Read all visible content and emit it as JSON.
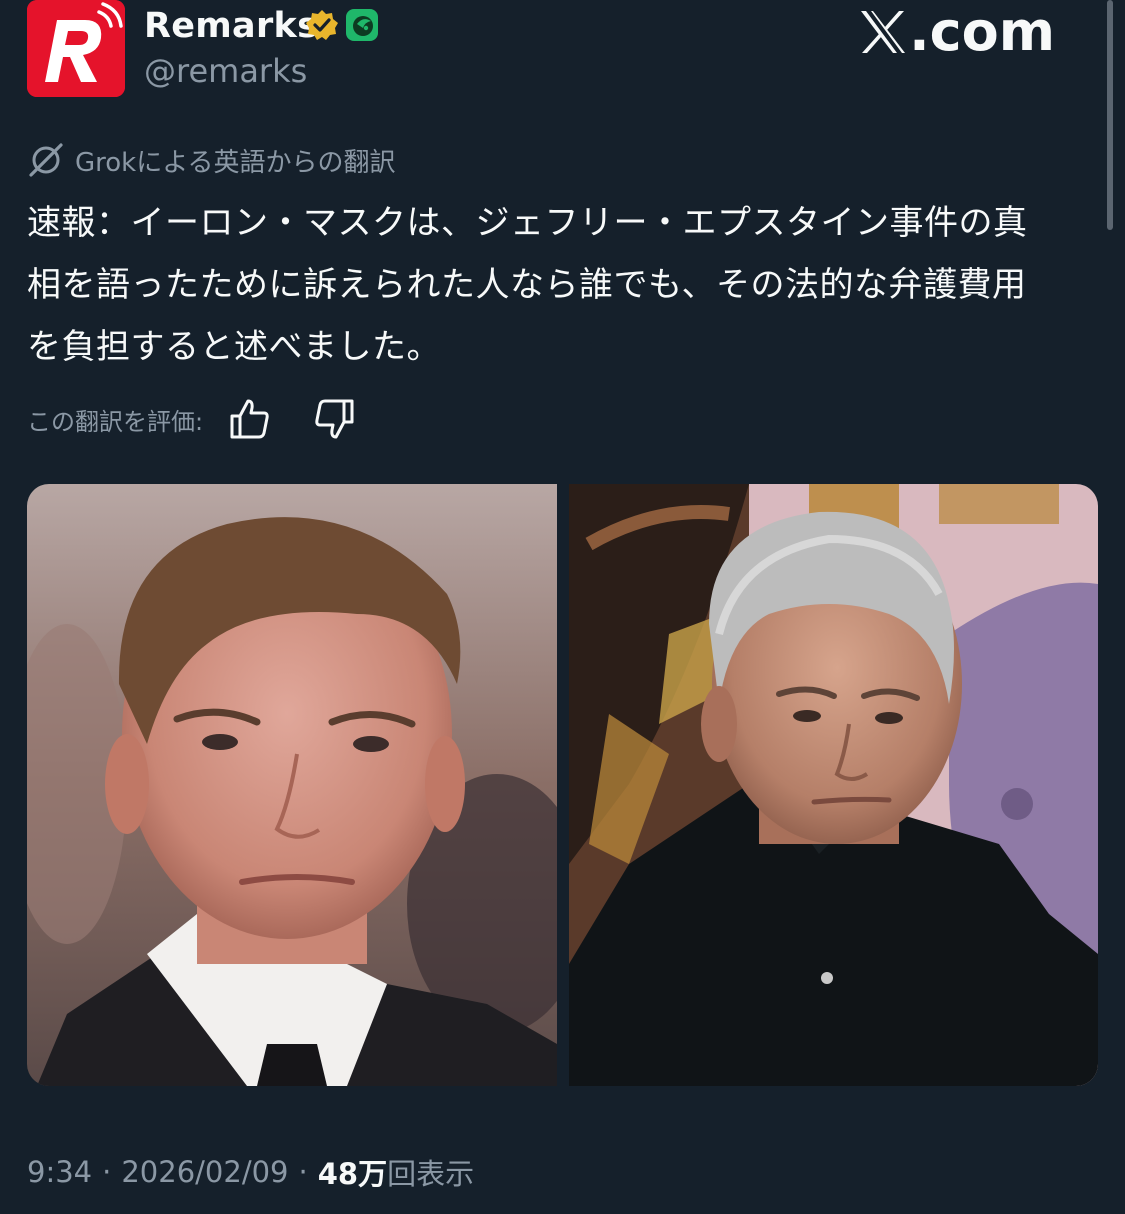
{
  "header": {
    "display_name": "Remarks",
    "handle": "@remarks",
    "brand_text": ".com",
    "badges": [
      "verified-gold-badge",
      "affiliate-green-badge"
    ]
  },
  "translation": {
    "label": "Grokによる英語からの翻訳"
  },
  "tweet": {
    "lines": [
      "速報：イーロン・マスクは、ジェフリー・エプスタイン事件の真",
      "相を語ったために訴えられた人なら誰でも、その法的な弁護費用",
      "を負担すると述べました。"
    ]
  },
  "rating": {
    "label": "この翻訳を評価:"
  },
  "meta": {
    "time": "9:34",
    "separator": "·",
    "date": "2026/02/09",
    "views_count": "48万",
    "views_label": "回表示"
  },
  "colors": {
    "background": "#15202b",
    "text": "#f7f9f9",
    "muted": "#8b98a5",
    "avatar_red": "#e5132b",
    "gold_badge": "#e8b52c",
    "green_badge": "#1fb76a"
  }
}
